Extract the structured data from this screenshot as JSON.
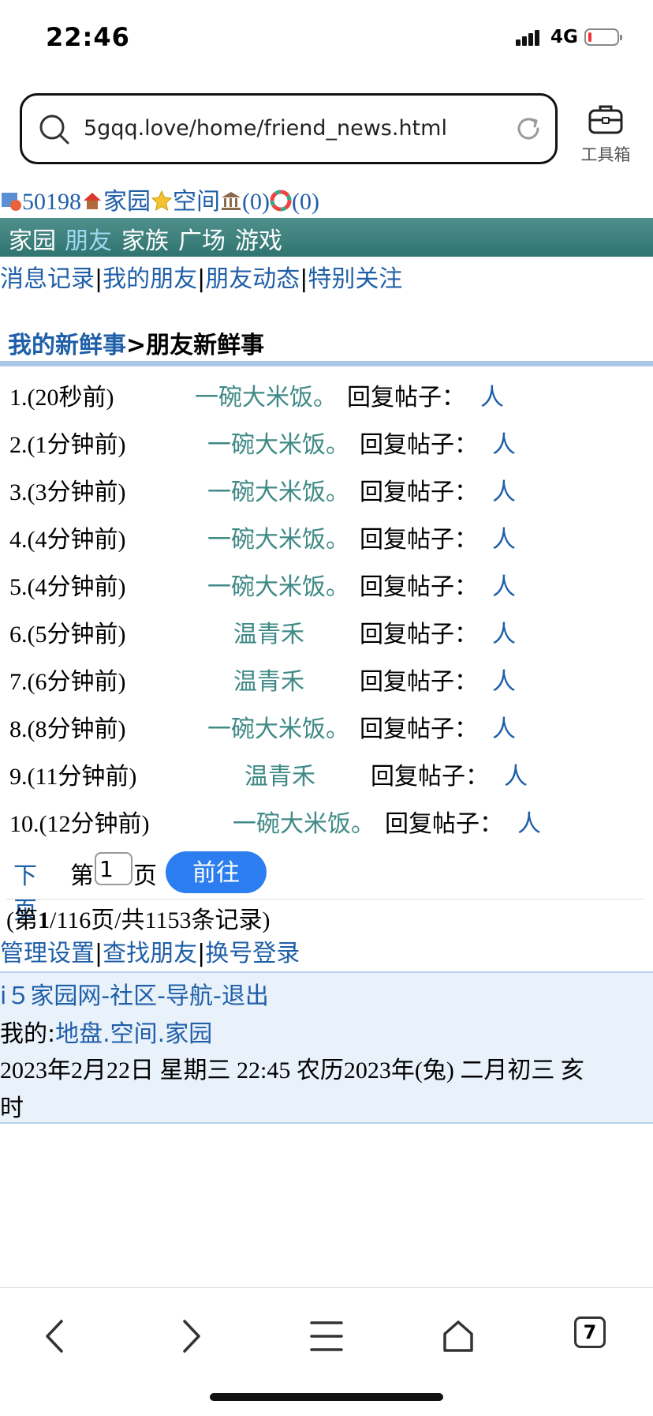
{
  "status": {
    "time": "22:46",
    "network": "4G"
  },
  "browser": {
    "url": "5gqq.love/home/friend_news.html",
    "toolbox_label": "工具箱",
    "tab_count": "7"
  },
  "userline": {
    "user_id": "50198",
    "home": "家园",
    "space": "空间",
    "count1": "(0)",
    "count2": "(0)"
  },
  "nav": [
    "家园",
    "朋友",
    "家族",
    "广场",
    "游戏"
  ],
  "subnav": [
    "消息记录",
    "我的朋友",
    "朋友动态",
    "特别关注"
  ],
  "breadcrumb": {
    "parent": "我的新鲜事",
    "separator": ">",
    "current": "朋友新鲜事"
  },
  "news": [
    {
      "index": "1.(20秒前)",
      "user": "一碗大米饭。",
      "action": "回复帖子：",
      "target": "人"
    },
    {
      "index": "2.(1分钟前)",
      "user": "一碗大米饭。",
      "action": "回复帖子：",
      "target": "人"
    },
    {
      "index": "3.(3分钟前)",
      "user": "一碗大米饭。",
      "action": "回复帖子：",
      "target": "人"
    },
    {
      "index": "4.(4分钟前)",
      "user": "一碗大米饭。",
      "action": "回复帖子：",
      "target": "人"
    },
    {
      "index": "5.(4分钟前)",
      "user": "一碗大米饭。",
      "action": "回复帖子：",
      "target": "人"
    },
    {
      "index": "6.(5分钟前)",
      "user": "温青禾",
      "action": "回复帖子：",
      "target": "人"
    },
    {
      "index": "7.(6分钟前)",
      "user": "温青禾",
      "action": "回复帖子：",
      "target": "人"
    },
    {
      "index": "8.(8分钟前)",
      "user": "一碗大米饭。",
      "action": "回复帖子：",
      "target": "人"
    },
    {
      "index": "9.(11分钟前)",
      "user": "温青禾",
      "action": "回复帖子：",
      "target": "人"
    },
    {
      "index": "10.(12分钟前)",
      "user": "一碗大米饭。",
      "action": "回复帖子：",
      "target": "人"
    }
  ],
  "pager": {
    "next": "下页",
    "page_prefix": "第",
    "page_value": "1",
    "page_suffix": "页",
    "go": "前往",
    "summary_open": "(第",
    "summary_page": "1",
    "summary_rest": "/116页/共1153条记录)"
  },
  "manage_links": [
    "管理设置",
    "查找朋友",
    "换号登录"
  ],
  "footer": {
    "site_links": [
      "i５家园网",
      "社区",
      "导航",
      "退出"
    ],
    "mine_label": "我的:",
    "mine_links": [
      "地盘",
      "空间",
      "家园"
    ],
    "datetime": "2023年2月22日  星期三  22:45  农历2023年(兔)  二月初三  亥时"
  },
  "colors": {
    "nav_band": "#2f7470",
    "link": "#1f5fa8",
    "user_link": "#3f8a86",
    "go_button": "#2c7ef0",
    "footer_bg": "#e9f1fa"
  }
}
